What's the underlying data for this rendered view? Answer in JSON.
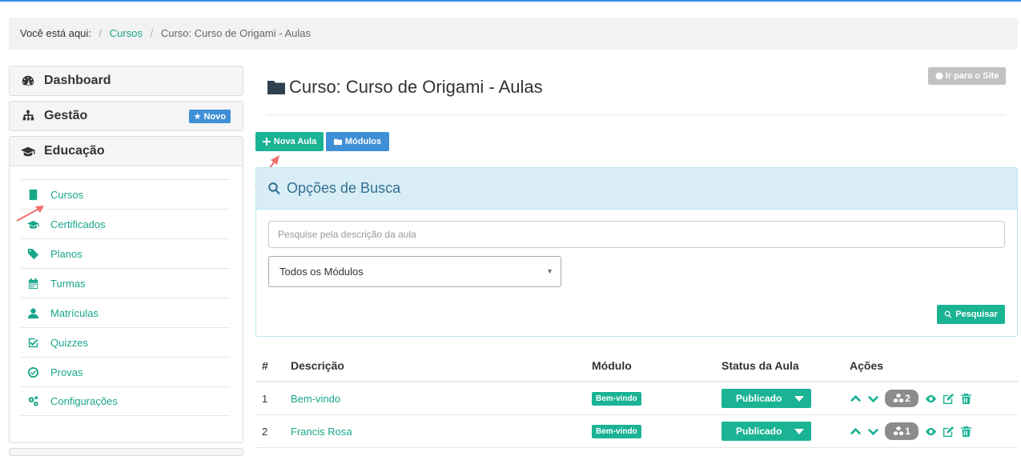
{
  "breadcrumb": {
    "label": "Você está aqui:",
    "sep": "/",
    "link": "Cursos",
    "current": "Curso: Curso de Origami - Aulas"
  },
  "sidebar": {
    "dashboard": "Dashboard",
    "gestao": "Gestão",
    "gestao_badge": "Novo",
    "educacao": "Educação",
    "items": [
      {
        "label": "Cursos",
        "icon": "book-icon"
      },
      {
        "label": "Certificados",
        "icon": "graduation-cap-icon"
      },
      {
        "label": "Planos",
        "icon": "tags-icon"
      },
      {
        "label": "Turmas",
        "icon": "calendar-icon"
      },
      {
        "label": "Matrículas",
        "icon": "user-icon"
      },
      {
        "label": "Quizzes",
        "icon": "check-square-icon"
      },
      {
        "label": "Provas",
        "icon": "check-circle-icon"
      },
      {
        "label": "Configurações",
        "icon": "gears-icon"
      }
    ]
  },
  "header": {
    "title": "Curso: Curso de Origami - Aulas",
    "site_button": "Ir para o Site"
  },
  "toolbar": {
    "new_lesson": "Nova Aula",
    "modules": "Módulos"
  },
  "search": {
    "title": "Opções de Busca",
    "placeholder": "Pesquise pela descrição da aula",
    "module_select": "Todos os Módulos",
    "submit": "Pesquisar"
  },
  "table": {
    "headers": [
      "#",
      "Descrição",
      "Módulo",
      "Status da Aula",
      "Ações"
    ],
    "rows": [
      {
        "num": "1",
        "desc": "Bem-vindo",
        "module": "Bem-vindo",
        "status": "Publicado",
        "count": "2"
      },
      {
        "num": "2",
        "desc": "Francis Rosa",
        "module": "Bem-vindo",
        "status": "Publicado",
        "count": "1"
      }
    ]
  },
  "colors": {
    "accent_green": "#1ab394",
    "accent_blue": "#3f8fd6",
    "annotation_arrow": "#f06f6f"
  }
}
